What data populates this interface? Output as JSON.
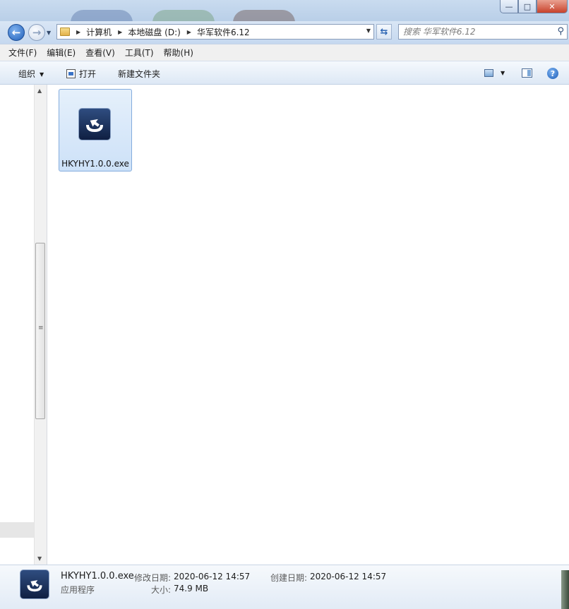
{
  "window": {
    "controls": {
      "minimize": "—",
      "maximize": "□",
      "close": "✕"
    }
  },
  "address": {
    "crumbs": [
      "计算机",
      "本地磁盘 (D:)",
      "华军软件6.12"
    ]
  },
  "search": {
    "placeholder": "搜索 华军软件6.12"
  },
  "menu": [
    "文件(F)",
    "编辑(E)",
    "查看(V)",
    "工具(T)",
    "帮助(H)"
  ],
  "toolbar": {
    "organize": "组织",
    "open": "打开",
    "new_folder": "新建文件夹"
  },
  "files": [
    {
      "name": "HKYHY1.0.0.exe",
      "selected": true
    }
  ],
  "details": {
    "name": "HKYHY1.0.0.exe",
    "type": "应用程序",
    "modified_label": "修改日期:",
    "modified_value": "2020-06-12 14:57",
    "size_label": "大小:",
    "size_value": "74.9 MB",
    "created_label": "创建日期:",
    "created_value": "2020-06-12 14:57"
  },
  "colors": {
    "selection_border": "#84acdd",
    "selection_fill": "#cde1f8",
    "app_icon_bg": "#1f3563"
  }
}
